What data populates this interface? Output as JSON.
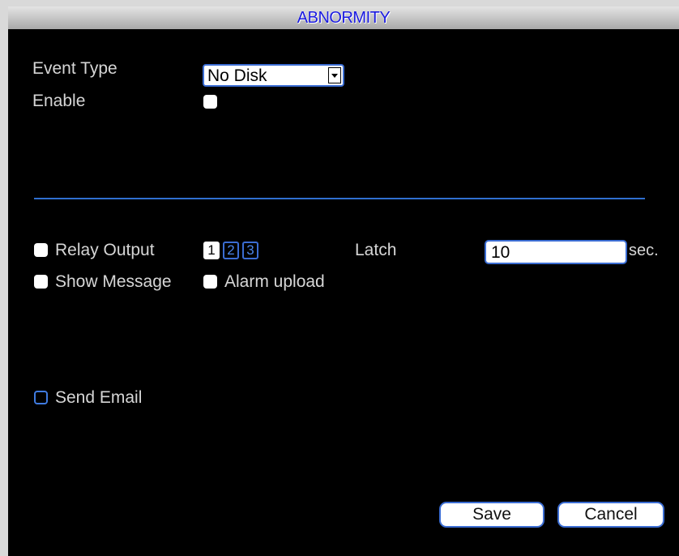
{
  "dialog": {
    "title": "ABNORMITY"
  },
  "event_type": {
    "label": "Event Type",
    "selected": "No Disk"
  },
  "enable": {
    "label": "Enable",
    "checked": true
  },
  "relay_output": {
    "label": "Relay Output",
    "checked": true,
    "channels": [
      "1",
      "2",
      "3"
    ],
    "active_channel": "1"
  },
  "latch": {
    "label": "Latch",
    "value": "10",
    "unit": "sec."
  },
  "show_message": {
    "label": "Show Message",
    "checked": true
  },
  "alarm_upload": {
    "label": "Alarm upload",
    "checked": true
  },
  "send_email": {
    "label": "Send Email",
    "checked": false
  },
  "buttons": {
    "save": "Save",
    "cancel": "Cancel"
  },
  "colors": {
    "accent": "#3b6dd3",
    "title_text": "#1a1ae0",
    "background": "#000000",
    "label_text": "#d6d6d6"
  }
}
